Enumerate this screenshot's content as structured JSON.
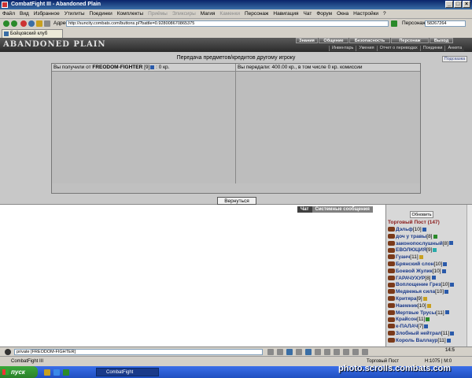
{
  "window": {
    "title": "CombatFight III - Abandoned Plain"
  },
  "menubar": [
    {
      "label": "Файл",
      "dim": false
    },
    {
      "label": "Вид",
      "dim": false
    },
    {
      "label": "Избранное",
      "dim": false
    },
    {
      "label": "Утилиты",
      "dim": false
    },
    {
      "label": "Поединки",
      "dim": false
    },
    {
      "label": "Комплекты",
      "dim": false
    },
    {
      "label": "Приёмы",
      "dim": true
    },
    {
      "label": "Эликсиры",
      "dim": true
    },
    {
      "label": "Магия",
      "dim": false
    },
    {
      "label": "Каменки",
      "dim": true
    },
    {
      "label": "Персонаж",
      "dim": false
    },
    {
      "label": "Навигация",
      "dim": false
    },
    {
      "label": "Чат",
      "dim": false
    },
    {
      "label": "Форум",
      "dim": false
    },
    {
      "label": "Окна",
      "dim": false
    },
    {
      "label": "Настройки",
      "dim": false
    },
    {
      "label": "?",
      "dim": false
    }
  ],
  "addressbar": {
    "label": "Адрес",
    "url": "http://suncity.combats.com/buttons.pl?battle=0.928008670865375",
    "person_label": "Персонаж",
    "person_value": "58267264"
  },
  "browser_tab": {
    "label": "Бойцовский клуб"
  },
  "game": {
    "logo": "ABANDONED PLAIN",
    "nav_top": [
      "Знания",
      "Общение",
      "Безопасность",
      "Персонаж",
      "Выход"
    ],
    "nav_sub": [
      "Инвентарь",
      "Умения",
      "Отчет о переводах",
      "Поединки",
      "Анкета"
    ]
  },
  "page": {
    "title": "Передача предметов/кредитов другому игроку",
    "hint_button": "Подсказка",
    "received_prefix": "Вы получили от",
    "received_from": "FREODOM-FIGHTER",
    "received_level": "[9]",
    "received_suffix": ": 0 кр.",
    "sent_text": "Вы передали: 400.00 кр., в том числе 0 кр. комиссии",
    "return_button": "Вернуться"
  },
  "chat": {
    "tabs": [
      "Чат",
      "Системные сообщения"
    ],
    "input_value": "private [FREODOM-FIGHTER]"
  },
  "player_list": {
    "refresh_button": "Обновить",
    "location": "Торговый Пост (147)",
    "players": [
      {
        "name": "Дэльф",
        "level": "[10]",
        "info": "b"
      },
      {
        "name": "доч у травы",
        "level": "[8]",
        "info": "g"
      },
      {
        "name": "законопослушный",
        "level": "[8]",
        "info": "b"
      },
      {
        "name": "ЕВОЛЮЦИЯ",
        "level": "[9]",
        "info": "c"
      },
      {
        "name": "Гуанч",
        "level": "[11]",
        "info": "y"
      },
      {
        "name": "Брянский слон",
        "level": "[10]",
        "info": "b"
      },
      {
        "name": "Боевой Жулик",
        "level": "[10]",
        "info": "b"
      },
      {
        "name": "ГАРАЧУХУР",
        "level": "[8]",
        "info": "b"
      },
      {
        "name": "Воплощение Грез",
        "level": "[10]",
        "info": "b"
      },
      {
        "name": "Медвежья сила",
        "level": "[10]",
        "info": "b"
      },
      {
        "name": "Критяра",
        "level": "[9]",
        "info": "y"
      },
      {
        "name": "Наемник",
        "level": "[10]",
        "info": "y"
      },
      {
        "name": "Мертвые Трусы",
        "level": "[11]",
        "info": "b"
      },
      {
        "name": "Крайсон",
        "level": "[11]",
        "info": "g"
      },
      {
        "name": "к-ПАЛАЧ",
        "level": "[7]",
        "info": "b"
      },
      {
        "name": "Злобный нейтрал",
        "level": "[11]",
        "info": "b"
      },
      {
        "name": "Король Валлаур",
        "level": "[11]",
        "info": "b"
      }
    ]
  },
  "toolbar": {
    "clock": "14:5"
  },
  "statusbar": {
    "left": "CombatFight III",
    "center": "Торговый Пост",
    "right": "H:1075 | M:0"
  },
  "taskbar": {
    "start": "пуск",
    "task": "CombatFight"
  },
  "watermark": "photo.scrolls.combats.com"
}
